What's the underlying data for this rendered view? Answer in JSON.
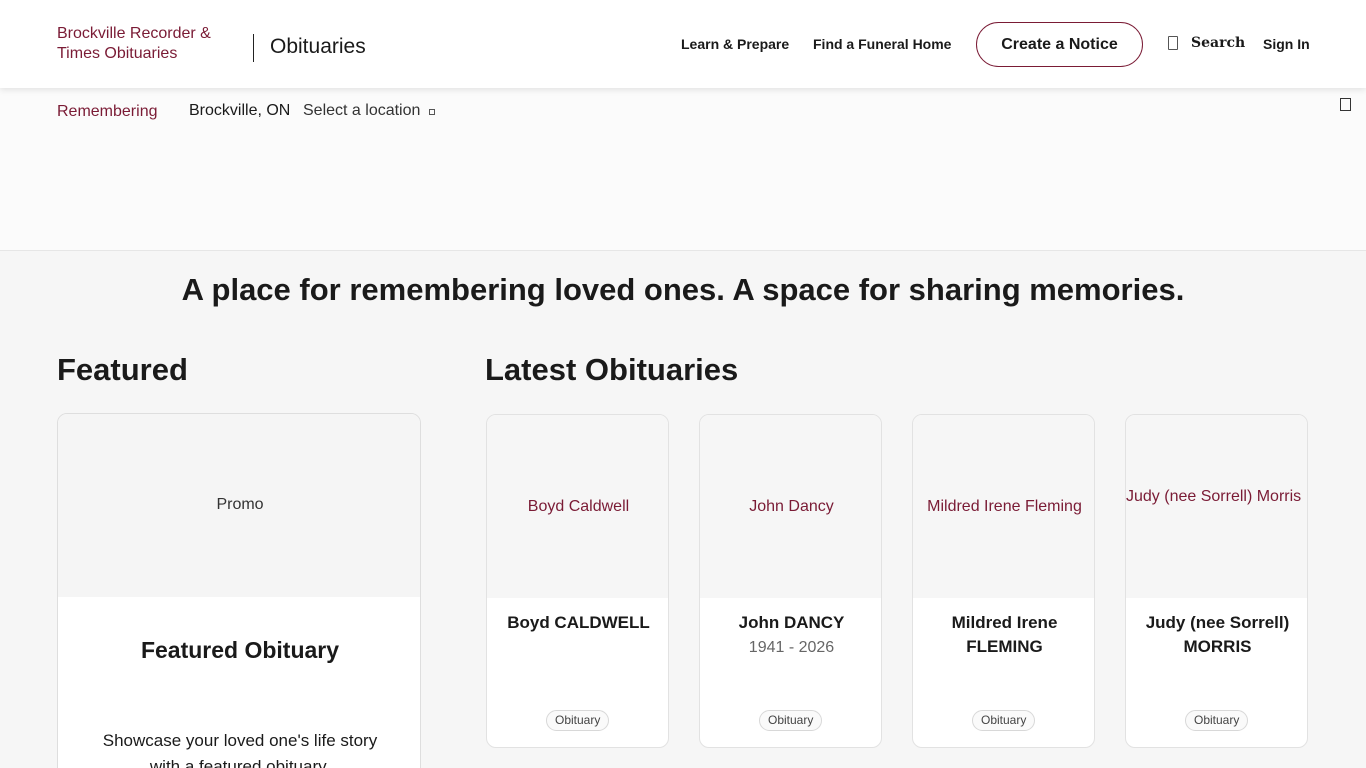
{
  "header": {
    "logo_alt": "Brockville Recorder & Times Obituaries",
    "brand": "Obituaries",
    "nav": {
      "learn": "Learn & Prepare",
      "find_funeral_home": "Find a Funeral Home",
      "create_notice": "Create a Notice",
      "search": "Search",
      "sign_in": "Sign In"
    }
  },
  "location_bar": {
    "logo_alt": "Remembering",
    "city": "Brockville, ON",
    "select_label": "Select a location"
  },
  "tagline": "A place for remembering loved ones. A space for sharing memories.",
  "featured": {
    "heading": "Featured",
    "image_alt": "Promo",
    "title": "Featured Obituary",
    "description": "Showcase your loved one's life story with a featured obituary."
  },
  "latest": {
    "heading": "Latest Obituaries",
    "items": [
      {
        "image_alt": "Boyd Caldwell",
        "name": "Boyd CALDWELL",
        "dates": "",
        "badge": "Obituary"
      },
      {
        "image_alt": "John Dancy",
        "name": "John DANCY",
        "dates": "1941 - 2026",
        "badge": "Obituary"
      },
      {
        "image_alt": "Mildred Irene Fleming",
        "name": "Mildred Irene FLEMING",
        "dates": "",
        "badge": "Obituary"
      },
      {
        "image_alt": "Judy (nee Sorrell) Morris",
        "name": "Judy (nee Sorrell) MORRIS",
        "dates": "",
        "badge": "Obituary"
      }
    ]
  },
  "colors": {
    "accent": "#7a1b35",
    "page_bg": "#f6f6f6",
    "header_bg": "#ffffff"
  },
  "icons": {
    "search": "search-icon",
    "location_dropdown": "chevron-down-icon",
    "corner": "bookmark-icon"
  }
}
